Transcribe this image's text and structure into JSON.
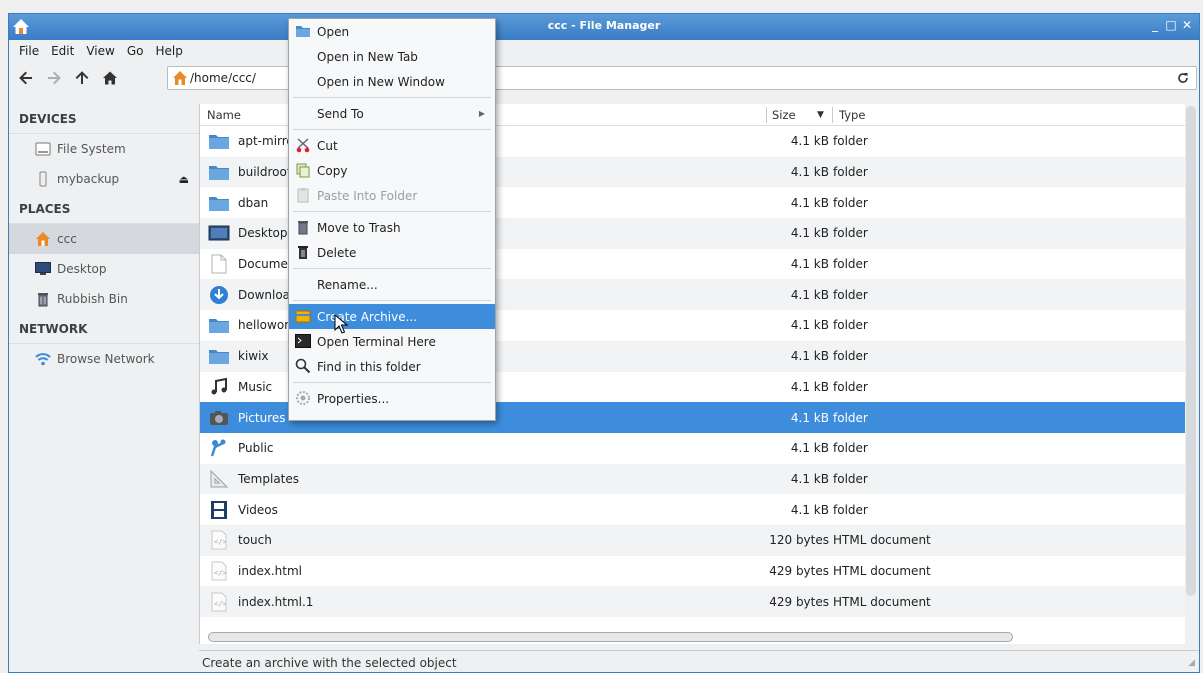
{
  "window": {
    "title": "ccc - File Manager",
    "controls": [
      "_",
      "□",
      "✕"
    ]
  },
  "menubar": [
    "File",
    "Edit",
    "View",
    "Go",
    "Help"
  ],
  "toolbar": {
    "path": "/home/ccc/"
  },
  "sidebar": {
    "devices_header": "DEVICES",
    "devices": [
      {
        "label": "File System",
        "icon": "drive-icon"
      },
      {
        "label": "mybackup",
        "icon": "usb-drive-icon"
      }
    ],
    "places_header": "PLACES",
    "places": [
      {
        "label": "ccc",
        "icon": "home-icon"
      },
      {
        "label": "Desktop",
        "icon": "desktop-icon"
      },
      {
        "label": "Rubbish Bin",
        "icon": "trash-icon"
      }
    ],
    "network_header": "NETWORK",
    "network": [
      {
        "label": "Browse Network",
        "icon": "wifi-icon"
      }
    ]
  },
  "columns": {
    "name": "Name",
    "size": "Size",
    "type": "Type"
  },
  "files": [
    {
      "name": "apt-mirror",
      "size": "4.1 kB",
      "type": "folder",
      "icon": "folder-icon"
    },
    {
      "name": "buildroot",
      "size": "4.1 kB",
      "type": "folder",
      "icon": "folder-icon"
    },
    {
      "name": "dban",
      "size": "4.1 kB",
      "type": "folder",
      "icon": "folder-icon"
    },
    {
      "name": "Desktop",
      "size": "4.1 kB",
      "type": "folder",
      "icon": "desktop-folder-icon"
    },
    {
      "name": "Documents",
      "size": "4.1 kB",
      "type": "folder",
      "icon": "documents-folder-icon"
    },
    {
      "name": "Downloads",
      "size": "4.1 kB",
      "type": "folder",
      "icon": "downloads-folder-icon"
    },
    {
      "name": "helloworld",
      "size": "4.1 kB",
      "type": "folder",
      "icon": "folder-icon"
    },
    {
      "name": "kiwix",
      "size": "4.1 kB",
      "type": "folder",
      "icon": "folder-icon"
    },
    {
      "name": "Music",
      "size": "4.1 kB",
      "type": "folder",
      "icon": "music-folder-icon"
    },
    {
      "name": "Pictures",
      "size": "4.1 kB",
      "type": "folder",
      "icon": "pictures-folder-icon",
      "selected": true
    },
    {
      "name": "Public",
      "size": "4.1 kB",
      "type": "folder",
      "icon": "public-folder-icon"
    },
    {
      "name": "Templates",
      "size": "4.1 kB",
      "type": "folder",
      "icon": "templates-folder-icon"
    },
    {
      "name": "Videos",
      "size": "4.1 kB",
      "type": "folder",
      "icon": "videos-folder-icon"
    },
    {
      "name": "touch",
      "size": "120 bytes",
      "type": "HTML document",
      "icon": "html-file-icon"
    },
    {
      "name": "index.html",
      "size": "429 bytes",
      "type": "HTML document",
      "icon": "html-file-icon"
    },
    {
      "name": "index.html.1",
      "size": "429 bytes",
      "type": "HTML document",
      "icon": "html-file-icon"
    }
  ],
  "context_menu": [
    {
      "label": "Open",
      "icon": "folder-icon"
    },
    {
      "label": "Open in New Tab"
    },
    {
      "label": "Open in New Window"
    },
    {
      "sep": true
    },
    {
      "label": "Send To",
      "submenu": true
    },
    {
      "sep": true
    },
    {
      "label": "Cut",
      "icon": "scissors-icon"
    },
    {
      "label": "Copy",
      "icon": "copy-icon"
    },
    {
      "label": "Paste Into Folder",
      "icon": "paste-icon",
      "disabled": true
    },
    {
      "sep": true
    },
    {
      "label": "Move to Trash",
      "icon": "trash-icon"
    },
    {
      "label": "Delete",
      "icon": "delete-icon"
    },
    {
      "sep": true
    },
    {
      "label": "Rename..."
    },
    {
      "sep": true
    },
    {
      "label": "Create Archive...",
      "icon": "archive-icon",
      "highlight": true
    },
    {
      "label": "Open Terminal Here",
      "icon": "terminal-icon"
    },
    {
      "label": "Find in this folder",
      "icon": "search-icon"
    },
    {
      "sep": true
    },
    {
      "label": "Properties...",
      "icon": "properties-icon"
    }
  ],
  "status": "Create an archive with the selected object",
  "colors": {
    "titlebar": "#3a7cc4",
    "selection": "#3e8ddd"
  }
}
